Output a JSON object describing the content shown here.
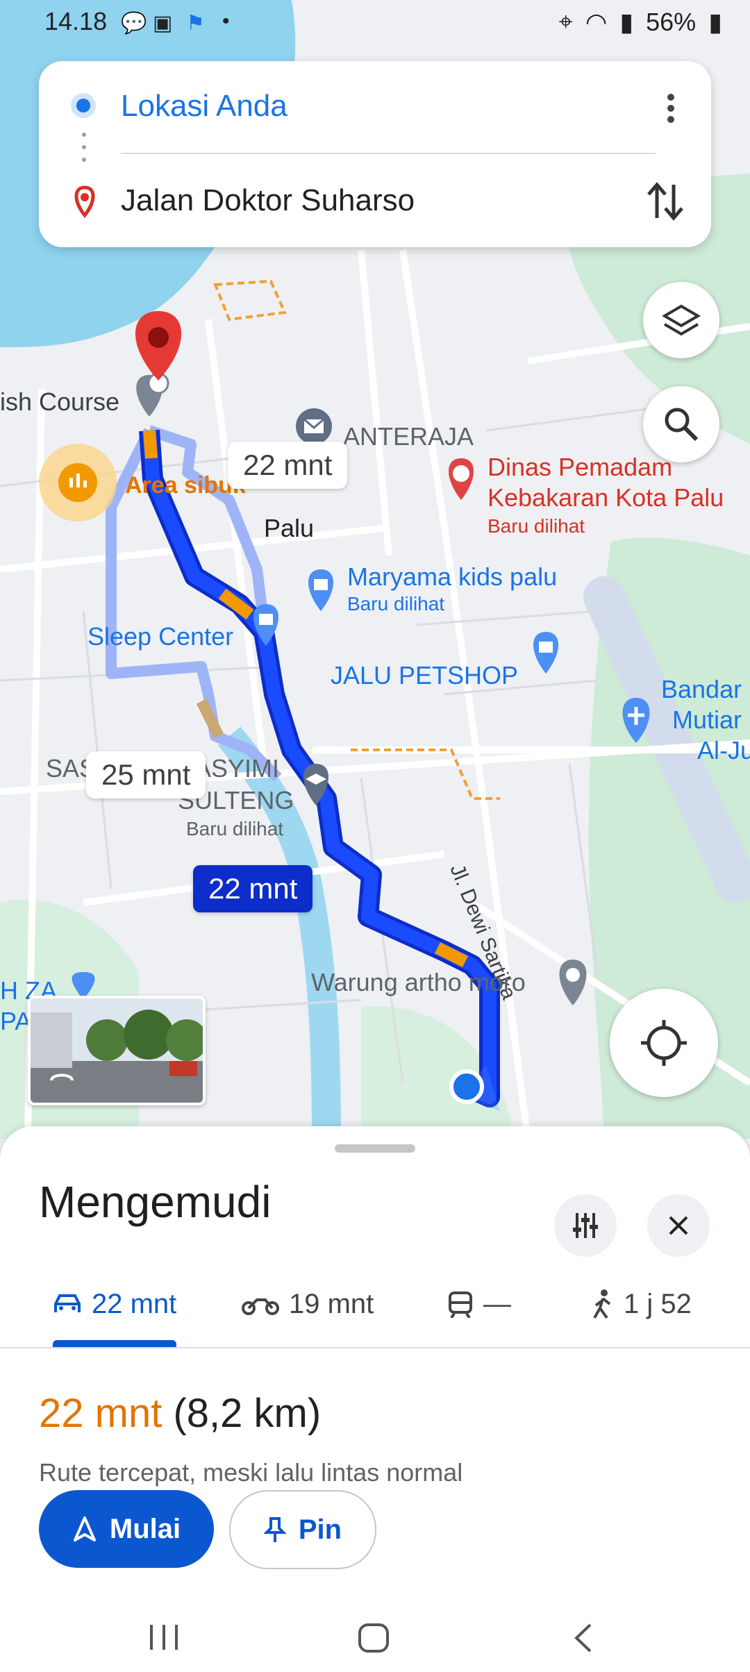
{
  "status_bar": {
    "time": "14.18",
    "battery": "56%"
  },
  "search": {
    "origin": "Lokasi Anda",
    "destination": "Jalan Doktor Suharso"
  },
  "map": {
    "labels": {
      "course": "ish Course",
      "anteraja": "ANTERAJA",
      "dinas1": "Dinas Pemadam",
      "dinas2": "Kebakaran Kota Palu",
      "dinas_recent": "Baru dilihat",
      "area": "Area sibuk",
      "palu": "Palu",
      "maryama": "Maryama kids palu",
      "maryama_recent": "Baru dilihat",
      "sleep": "Sleep Center",
      "jalu": "JALU PETSHOP",
      "bandar1": "Bandar",
      "bandar2": "Mutiar",
      "bandar3": "Al-Ju",
      "sas": "SAS",
      "asyimi": "ASYIMI",
      "sulteng": "SULTENG",
      "sulteng_recent": "Baru dilihat",
      "dewi": "Jl. Dewi Sartika",
      "warung": "Warung artho moro",
      "hza1": "H ZA",
      "hza2": "PA"
    },
    "route_times": {
      "alt1": "22 mnt",
      "alt2": "25 mnt",
      "main": "22 mnt"
    }
  },
  "sheet": {
    "title": "Mengemudi",
    "modes": [
      {
        "icon": "car-icon",
        "label": "22 mnt"
      },
      {
        "icon": "motorcycle-icon",
        "label": "19 mnt"
      },
      {
        "icon": "transit-icon",
        "label": "—"
      },
      {
        "icon": "walk-icon",
        "label": "1 j 52"
      }
    ],
    "eta_time": "22 mnt",
    "eta_distance": "(8,2 km)",
    "description": "Rute tercepat, meski lalu lintas normal",
    "start_label": "Mulai",
    "pin_label": "Pin"
  },
  "colors": {
    "accent": "#0b57d0",
    "route": "#1a3ef0",
    "eta": "#e37400",
    "water": "#8fd3ef"
  }
}
